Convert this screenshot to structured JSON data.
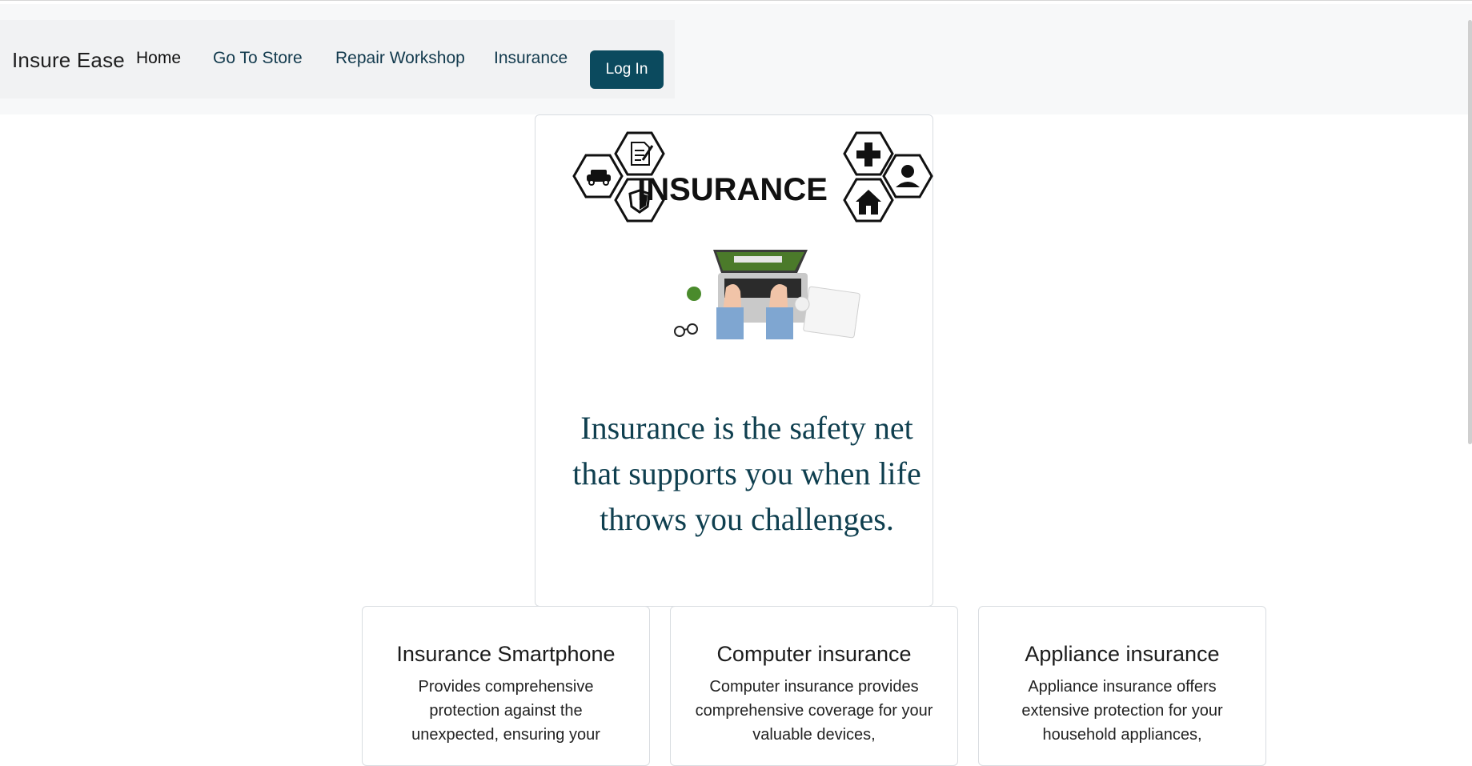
{
  "navbar": {
    "brand": "Insure Ease",
    "links": [
      "Home",
      "Go To Store",
      "Repair Workshop",
      "Insurance"
    ],
    "login_label": "Log In"
  },
  "hero": {
    "logo_word": "INSURANCE",
    "tagline": "Insurance is the safety net that supports you when life throws you challenges."
  },
  "services": [
    {
      "title": "Insurance Smartphone",
      "description": "Provides comprehensive protection against the unexpected, ensuring your"
    },
    {
      "title": "Computer insurance",
      "description": "Computer insurance provides comprehensive coverage for your valuable devices,"
    },
    {
      "title": "Appliance insurance",
      "description": "Appliance insurance offers extensive protection for your household appliances,"
    }
  ],
  "colors": {
    "accent": "#0b4a5e",
    "tagline": "#0f3f4f",
    "nav_bg": "#f1f2f3"
  }
}
